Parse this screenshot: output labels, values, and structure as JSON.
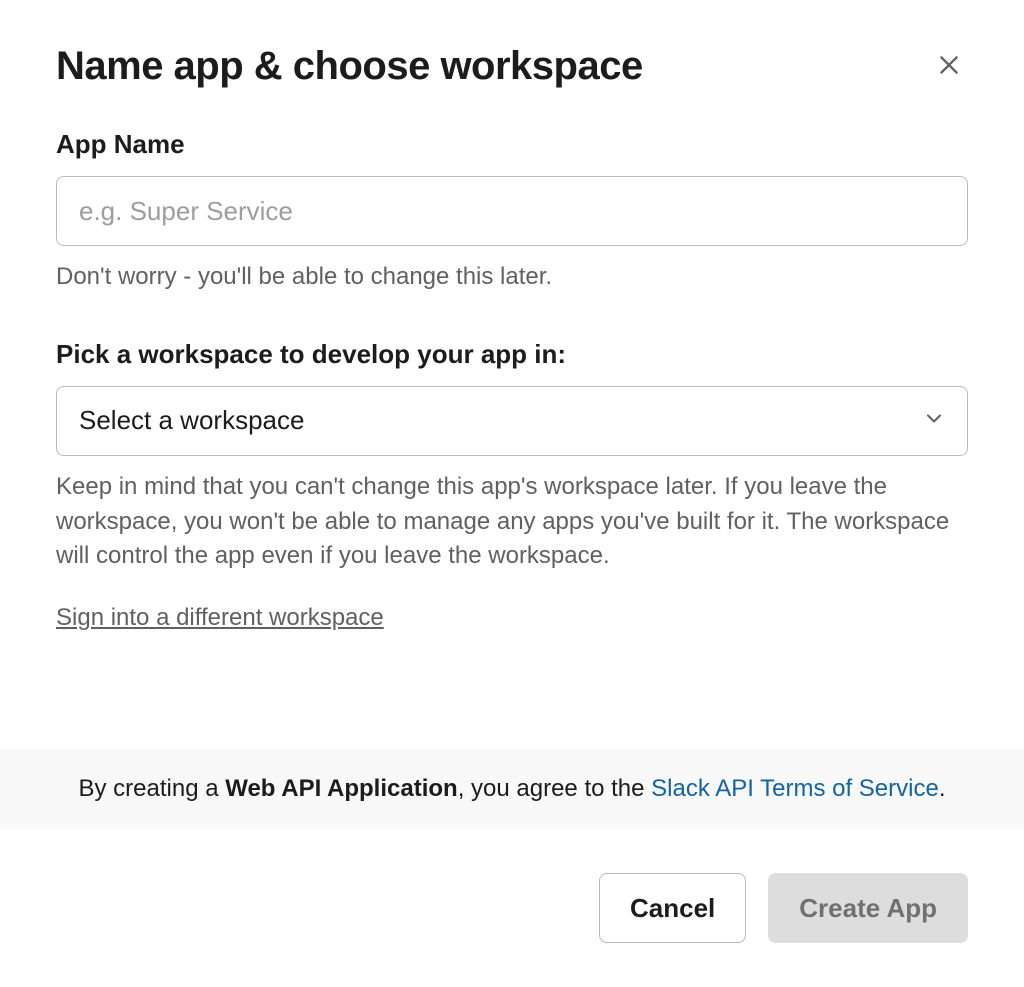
{
  "modal": {
    "title": "Name app & choose workspace",
    "appName": {
      "label": "App Name",
      "placeholder": "e.g. Super Service",
      "value": "",
      "helper": "Don't worry - you'll be able to change this later."
    },
    "workspace": {
      "label": "Pick a workspace to develop your app in:",
      "placeholder": "Select a workspace",
      "helper": "Keep in mind that you can't change this app's workspace later. If you leave the workspace, you won't be able to manage any apps you've built for it. The workspace will control the app even if you leave the workspace."
    },
    "signinLink": "Sign into a different workspace",
    "terms": {
      "prefix": "By creating a ",
      "bold": "Web API Application",
      "middle": ", you agree to the ",
      "linkText": "Slack API Terms of Service",
      "suffix": "."
    },
    "buttons": {
      "cancel": "Cancel",
      "create": "Create App"
    }
  }
}
